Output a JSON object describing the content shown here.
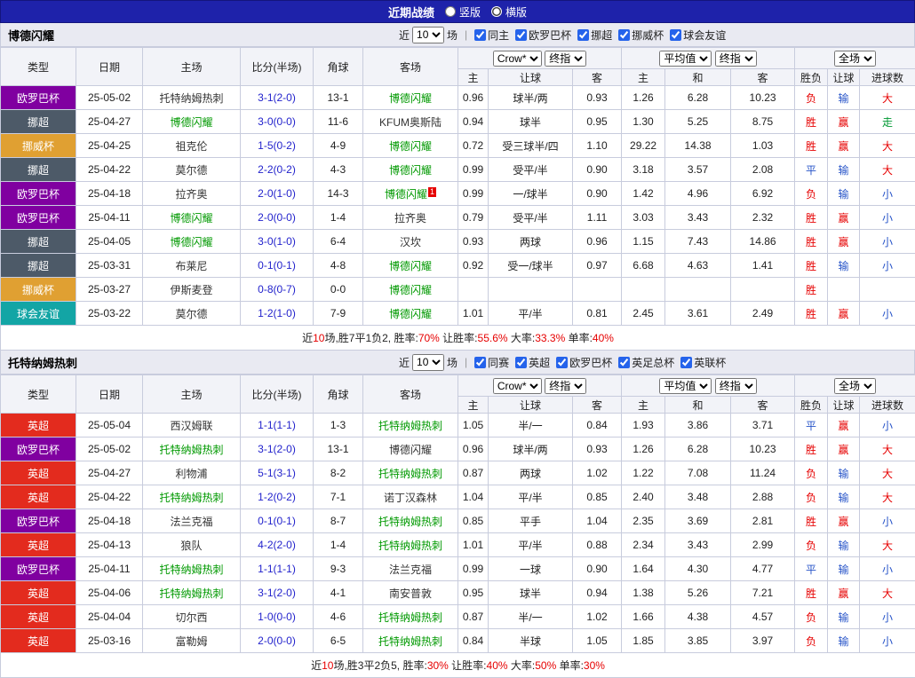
{
  "title_bar": {
    "title": "近期战绩",
    "layout_options": [
      {
        "label": "竖版",
        "selected": false
      },
      {
        "label": "横版",
        "selected": true
      }
    ]
  },
  "table_header": {
    "col_type": "类型",
    "col_date": "日期",
    "col_home": "主场",
    "col_score": "比分(半场)",
    "col_corner": "角球",
    "col_away": "客场",
    "sub_home": "主",
    "sub_handicap": "让球",
    "sub_away": "客",
    "sub_avg_home": "主",
    "sub_draw": "和",
    "sub_avg_away": "客",
    "sub_result": "胜负",
    "sub_handicap_result": "让球",
    "sub_goals": "进球数",
    "bookmaker_select": "Crow*",
    "stage_select": "终指",
    "avg_select": "平均值",
    "avg_stage_select": "终指",
    "scope_select": "全场",
    "recent_prefix": "近",
    "recent_value": "10",
    "recent_suffix": "场",
    "separator": "|"
  },
  "palette": {
    "red": "#e60000",
    "blue": "#2653c8",
    "green": "#009933",
    "score_blue": "#2222cc",
    "focus_green": "#009900",
    "opponent": "#333333",
    "titlebar_blue": "#1e22aa"
  },
  "league_colors": {
    "欧罗巴杯": "#8000a0",
    "挪超": "#4d5a68",
    "挪威杯": "#e0a032",
    "球会友谊": "#13a5a5",
    "英超": "#e32b1e"
  },
  "result_colors": {
    "胜": "#e60000",
    "平": "#2653c8",
    "负": "#e60000",
    "赢": "#e60000",
    "输": "#2653c8",
    "走": "#009933",
    "大": "#e60000",
    "小": "#2653c8"
  },
  "sections": [
    {
      "team": "博德闪耀",
      "filters": [
        {
          "label": "同主",
          "checked": true
        },
        {
          "label": "欧罗巴杯",
          "checked": true
        },
        {
          "label": "挪超",
          "checked": true
        },
        {
          "label": "挪威杯",
          "checked": true
        },
        {
          "label": "球会友谊",
          "checked": true
        }
      ],
      "rows": [
        {
          "league": "欧罗巴杯",
          "date": "25-05-02",
          "home": "托特纳姆热刺",
          "home_focus": false,
          "score": "3-1(2-0)",
          "corners": "13-1",
          "away": "博德闪耀",
          "away_focus": true,
          "odds": [
            "0.96",
            "球半/两",
            "0.93"
          ],
          "avg": [
            "1.26",
            "6.28",
            "10.23"
          ],
          "results": [
            "负",
            "输",
            "大"
          ]
        },
        {
          "league": "挪超",
          "date": "25-04-27",
          "home": "博德闪耀",
          "home_focus": true,
          "score": "3-0(0-0)",
          "corners": "11-6",
          "away": "KFUM奥斯陆",
          "away_focus": false,
          "odds": [
            "0.94",
            "球半",
            "0.95"
          ],
          "avg": [
            "1.30",
            "5.25",
            "8.75"
          ],
          "results": [
            "胜",
            "赢",
            "走"
          ]
        },
        {
          "league": "挪威杯",
          "date": "25-04-25",
          "home": "祖克伦",
          "home_focus": false,
          "score": "1-5(0-2)",
          "corners": "4-9",
          "away": "博德闪耀",
          "away_focus": true,
          "odds": [
            "0.72",
            "受三球半/四",
            "1.10"
          ],
          "avg": [
            "29.22",
            "14.38",
            "1.03"
          ],
          "results": [
            "胜",
            "赢",
            "大"
          ]
        },
        {
          "league": "挪超",
          "date": "25-04-22",
          "home": "莫尔德",
          "home_focus": false,
          "score": "2-2(0-2)",
          "corners": "4-3",
          "away": "博德闪耀",
          "away_focus": true,
          "odds": [
            "0.99",
            "受平/半",
            "0.90"
          ],
          "avg": [
            "3.18",
            "3.57",
            "2.08"
          ],
          "results": [
            "平",
            "输",
            "大"
          ]
        },
        {
          "league": "欧罗巴杯",
          "date": "25-04-18",
          "home": "拉齐奥",
          "home_focus": false,
          "score": "2-0(1-0)",
          "corners": "14-3",
          "away": "博德闪耀",
          "away_focus": true,
          "away_badge": "1",
          "odds": [
            "0.99",
            "一/球半",
            "0.90"
          ],
          "avg": [
            "1.42",
            "4.96",
            "6.92"
          ],
          "results": [
            "负",
            "输",
            "小"
          ]
        },
        {
          "league": "欧罗巴杯",
          "date": "25-04-11",
          "home": "博德闪耀",
          "home_focus": true,
          "score": "2-0(0-0)",
          "corners": "1-4",
          "away": "拉齐奥",
          "away_focus": false,
          "odds": [
            "0.79",
            "受平/半",
            "1.11"
          ],
          "avg": [
            "3.03",
            "3.43",
            "2.32"
          ],
          "results": [
            "胜",
            "赢",
            "小"
          ]
        },
        {
          "league": "挪超",
          "date": "25-04-05",
          "home": "博德闪耀",
          "home_focus": true,
          "score": "3-0(1-0)",
          "corners": "6-4",
          "away": "汉坎",
          "away_focus": false,
          "odds": [
            "0.93",
            "两球",
            "0.96"
          ],
          "avg": [
            "1.15",
            "7.43",
            "14.86"
          ],
          "results": [
            "胜",
            "赢",
            "小"
          ]
        },
        {
          "league": "挪超",
          "date": "25-03-31",
          "home": "布莱尼",
          "home_focus": false,
          "score": "0-1(0-1)",
          "corners": "4-8",
          "away": "博德闪耀",
          "away_focus": true,
          "odds": [
            "0.92",
            "受一/球半",
            "0.97"
          ],
          "avg": [
            "6.68",
            "4.63",
            "1.41"
          ],
          "results": [
            "胜",
            "输",
            "小"
          ]
        },
        {
          "league": "挪威杯",
          "date": "25-03-27",
          "home": "伊斯麦登",
          "home_focus": false,
          "score": "0-8(0-7)",
          "corners": "0-0",
          "away": "博德闪耀",
          "away_focus": true,
          "odds": [
            "",
            "",
            ""
          ],
          "avg": [
            "",
            "",
            ""
          ],
          "results": [
            "胜",
            "",
            ""
          ]
        },
        {
          "league": "球会友谊",
          "date": "25-03-22",
          "home": "莫尔德",
          "home_focus": false,
          "score": "1-2(1-0)",
          "corners": "7-9",
          "away": "博德闪耀",
          "away_focus": true,
          "odds": [
            "1.01",
            "平/半",
            "0.81"
          ],
          "avg": [
            "2.45",
            "3.61",
            "2.49"
          ],
          "results": [
            "胜",
            "赢",
            "小"
          ]
        }
      ],
      "summary_segments": [
        {
          "text": "近",
          "red": false
        },
        {
          "text": "10",
          "red": true
        },
        {
          "text": "场,胜7平1负2,  ",
          "red": false
        },
        {
          "text": "胜率:",
          "red": false
        },
        {
          "text": "70%",
          "red": true
        },
        {
          "text": "  让胜率:",
          "red": false
        },
        {
          "text": "55.6%",
          "red": true
        },
        {
          "text": "  大率:",
          "red": false
        },
        {
          "text": "33.3%",
          "red": true
        },
        {
          "text": "  单率:",
          "red": false
        },
        {
          "text": "40%",
          "red": true
        }
      ]
    },
    {
      "team": "托特纳姆热刺",
      "filters": [
        {
          "label": "同赛",
          "checked": true
        },
        {
          "label": "英超",
          "checked": true
        },
        {
          "label": "欧罗巴杯",
          "checked": true
        },
        {
          "label": "英足总杯",
          "checked": true
        },
        {
          "label": "英联杯",
          "checked": true
        }
      ],
      "rows": [
        {
          "league": "英超",
          "date": "25-05-04",
          "home": "西汉姆联",
          "home_focus": false,
          "score": "1-1(1-1)",
          "corners": "1-3",
          "away": "托特纳姆热刺",
          "away_focus": true,
          "odds": [
            "1.05",
            "半/一",
            "0.84"
          ],
          "avg": [
            "1.93",
            "3.86",
            "3.71"
          ],
          "results": [
            "平",
            "赢",
            "小"
          ]
        },
        {
          "league": "欧罗巴杯",
          "date": "25-05-02",
          "home": "托特纳姆热刺",
          "home_focus": true,
          "score": "3-1(2-0)",
          "corners": "13-1",
          "away": "博德闪耀",
          "away_focus": false,
          "odds": [
            "0.96",
            "球半/两",
            "0.93"
          ],
          "avg": [
            "1.26",
            "6.28",
            "10.23"
          ],
          "results": [
            "胜",
            "赢",
            "大"
          ]
        },
        {
          "league": "英超",
          "date": "25-04-27",
          "home": "利物浦",
          "home_focus": false,
          "score": "5-1(3-1)",
          "corners": "8-2",
          "away": "托特纳姆热刺",
          "away_focus": true,
          "odds": [
            "0.87",
            "两球",
            "1.02"
          ],
          "avg": [
            "1.22",
            "7.08",
            "11.24"
          ],
          "results": [
            "负",
            "输",
            "大"
          ]
        },
        {
          "league": "英超",
          "date": "25-04-22",
          "home": "托特纳姆热刺",
          "home_focus": true,
          "score": "1-2(0-2)",
          "corners": "7-1",
          "away": "诺丁汉森林",
          "away_focus": false,
          "odds": [
            "1.04",
            "平/半",
            "0.85"
          ],
          "avg": [
            "2.40",
            "3.48",
            "2.88"
          ],
          "results": [
            "负",
            "输",
            "大"
          ]
        },
        {
          "league": "欧罗巴杯",
          "date": "25-04-18",
          "home": "法兰克福",
          "home_focus": false,
          "score": "0-1(0-1)",
          "corners": "8-7",
          "away": "托特纳姆热刺",
          "away_focus": true,
          "odds": [
            "0.85",
            "平手",
            "1.04"
          ],
          "avg": [
            "2.35",
            "3.69",
            "2.81"
          ],
          "results": [
            "胜",
            "赢",
            "小"
          ]
        },
        {
          "league": "英超",
          "date": "25-04-13",
          "home": "狼队",
          "home_focus": false,
          "score": "4-2(2-0)",
          "corners": "1-4",
          "away": "托特纳姆热刺",
          "away_focus": true,
          "odds": [
            "1.01",
            "平/半",
            "0.88"
          ],
          "avg": [
            "2.34",
            "3.43",
            "2.99"
          ],
          "results": [
            "负",
            "输",
            "大"
          ]
        },
        {
          "league": "欧罗巴杯",
          "date": "25-04-11",
          "home": "托特纳姆热刺",
          "home_focus": true,
          "score": "1-1(1-1)",
          "corners": "9-3",
          "away": "法兰克福",
          "away_focus": false,
          "odds": [
            "0.99",
            "一球",
            "0.90"
          ],
          "avg": [
            "1.64",
            "4.30",
            "4.77"
          ],
          "results": [
            "平",
            "输",
            "小"
          ]
        },
        {
          "league": "英超",
          "date": "25-04-06",
          "home": "托特纳姆热刺",
          "home_focus": true,
          "score": "3-1(2-0)",
          "corners": "4-1",
          "away": "南安普敦",
          "away_focus": false,
          "odds": [
            "0.95",
            "球半",
            "0.94"
          ],
          "avg": [
            "1.38",
            "5.26",
            "7.21"
          ],
          "results": [
            "胜",
            "赢",
            "大"
          ]
        },
        {
          "league": "英超",
          "date": "25-04-04",
          "home": "切尔西",
          "home_focus": false,
          "score": "1-0(0-0)",
          "corners": "4-6",
          "away": "托特纳姆热刺",
          "away_focus": true,
          "odds": [
            "0.87",
            "半/一",
            "1.02"
          ],
          "avg": [
            "1.66",
            "4.38",
            "4.57"
          ],
          "results": [
            "负",
            "输",
            "小"
          ]
        },
        {
          "league": "英超",
          "date": "25-03-16",
          "home": "富勒姆",
          "home_focus": false,
          "score": "2-0(0-0)",
          "corners": "6-5",
          "away": "托特纳姆热刺",
          "away_focus": true,
          "odds": [
            "0.84",
            "半球",
            "1.05"
          ],
          "avg": [
            "1.85",
            "3.85",
            "3.97"
          ],
          "results": [
            "负",
            "输",
            "小"
          ]
        }
      ],
      "summary_segments": [
        {
          "text": "近",
          "red": false
        },
        {
          "text": "10",
          "red": true
        },
        {
          "text": "场,胜3平2负5,  ",
          "red": false
        },
        {
          "text": "胜率:",
          "red": false
        },
        {
          "text": "30%",
          "red": true
        },
        {
          "text": "  让胜率:",
          "red": false
        },
        {
          "text": "40%",
          "red": true
        },
        {
          "text": "  大率:",
          "red": false
        },
        {
          "text": "50%",
          "red": true
        },
        {
          "text": "  单率:",
          "red": false
        },
        {
          "text": "30%",
          "red": true
        }
      ]
    }
  ]
}
